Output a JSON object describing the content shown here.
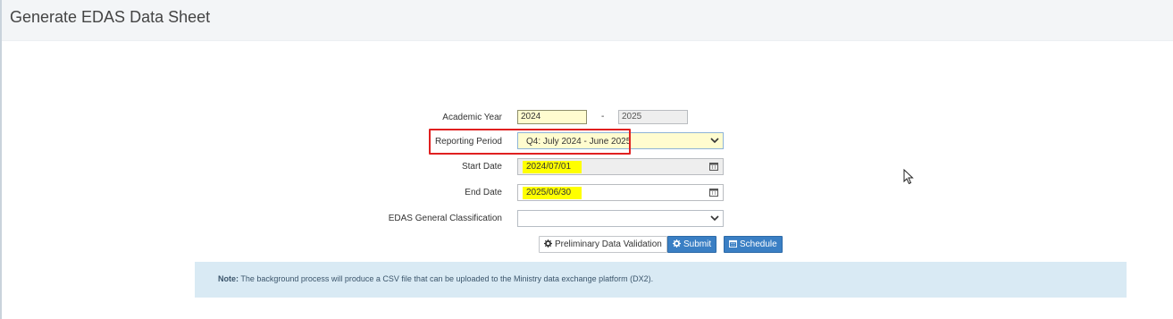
{
  "header": {
    "title": "Generate EDAS Data Sheet"
  },
  "form": {
    "academic_year_label": "Academic Year",
    "academic_year_start": "2024",
    "academic_year_separator": "-",
    "academic_year_end": "2025",
    "reporting_period_label": "Reporting Period",
    "reporting_period_value": "Q4: July 2024 - June 2025",
    "start_date_label": "Start Date",
    "start_date_value": "2024/07/01",
    "end_date_label": "End Date",
    "end_date_value": "2025/06/30",
    "classification_label": "EDAS General Classification",
    "classification_value": ""
  },
  "buttons": {
    "validation": "Preliminary Data Validation",
    "submit": "Submit",
    "schedule": "Schedule"
  },
  "note": {
    "prefix": "Note:",
    "text": " The background process will produce a CSV file that can be uploaded to the Ministry data exchange platform (DX2)."
  },
  "colors": {
    "highlight": "#ffff00",
    "annotation_box": "#e02020",
    "primary_button": "#3a7fc4",
    "note_background": "#d9eaf4"
  },
  "icons": [
    "calendar-icon",
    "chevron-down-icon",
    "gear-icon",
    "cursor-icon"
  ]
}
